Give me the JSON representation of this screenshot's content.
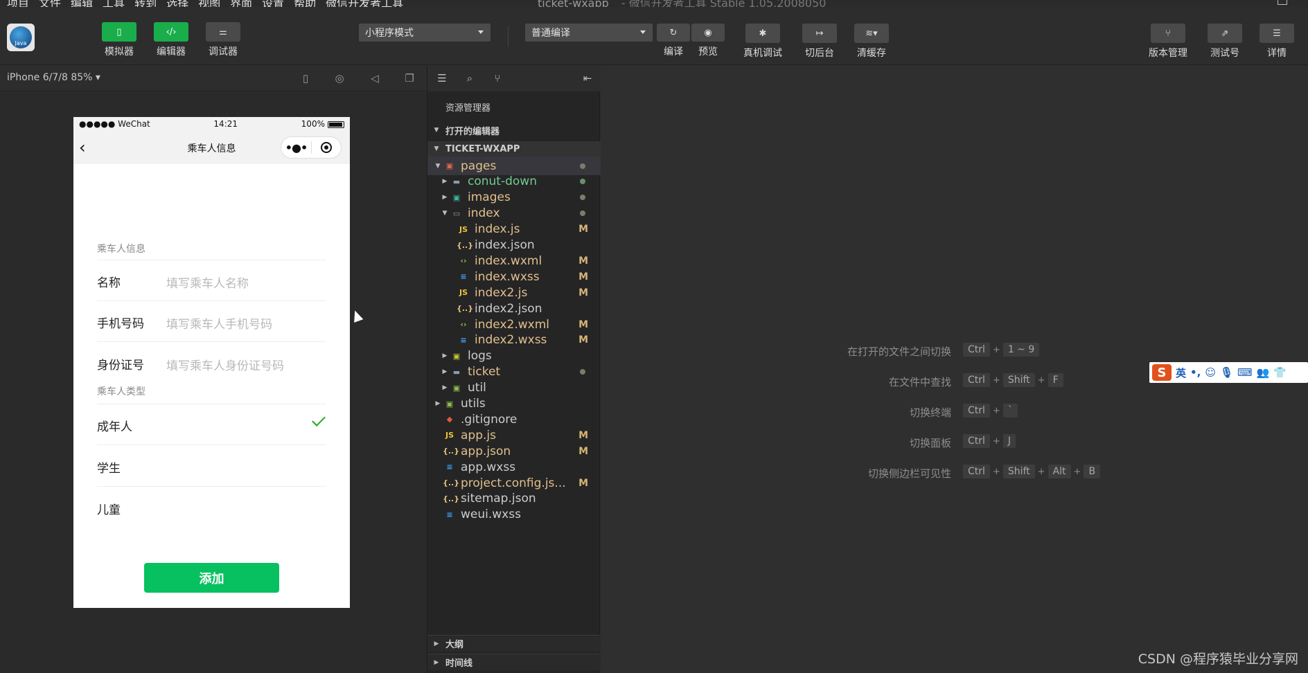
{
  "menu": {
    "items": [
      "项目",
      "文件",
      "编辑",
      "工具",
      "转到",
      "选择",
      "视图",
      "界面",
      "设置",
      "帮助",
      "微信开发者工具"
    ],
    "window_title": "ticket-wxapp",
    "window_subtitle": "- 微信开发者工具 Stable 1.05.2008050"
  },
  "toolbar": {
    "simulator": "模拟器",
    "editor": "编辑器",
    "debugger": "调试器",
    "mode_select": "小程序模式",
    "compile_select": "普通编译",
    "compile": "编译",
    "preview": "预览",
    "real_debug": "真机调试",
    "background": "切后台",
    "clear_cache": "清缓存",
    "version": "版本管理",
    "test_id": "测试号",
    "details": "详情"
  },
  "simulator": {
    "device": "iPhone 6/7/8 85% ▾",
    "status_left": "●●●●● WeChat",
    "status_time": "14:21",
    "status_battery": "100%",
    "nav_title": "乘车人信息",
    "section1": "乘车人信息",
    "field_name_label": "名称",
    "field_name_placeholder": "填写乘车人名称",
    "field_phone_label": "手机号码",
    "field_phone_placeholder": "填写乘车人手机号码",
    "field_id_label": "身份证号",
    "field_id_placeholder": "填写乘车人身份证号码",
    "section2": "乘车人类型",
    "type_adult": "成年人",
    "type_student": "学生",
    "type_child": "儿童",
    "add_button": "添加"
  },
  "explorer": {
    "title": "资源管理器",
    "open_editors": "打开的编辑器",
    "project": "TICKET-WXAPP",
    "outline": "大纲",
    "timeline": "时间线",
    "files": [
      {
        "name": "pages",
        "badge": ""
      },
      {
        "name": "conut-down",
        "badge": ""
      },
      {
        "name": "images",
        "badge": ""
      },
      {
        "name": "index",
        "badge": ""
      },
      {
        "name": "index.js",
        "badge": "M"
      },
      {
        "name": "index.json",
        "badge": ""
      },
      {
        "name": "index.wxml",
        "badge": "M"
      },
      {
        "name": "index.wxss",
        "badge": "M"
      },
      {
        "name": "index2.js",
        "badge": "M"
      },
      {
        "name": "index2.json",
        "badge": ""
      },
      {
        "name": "index2.wxml",
        "badge": "M"
      },
      {
        "name": "index2.wxss",
        "badge": "M"
      },
      {
        "name": "logs",
        "badge": ""
      },
      {
        "name": "ticket",
        "badge": ""
      },
      {
        "name": "util",
        "badge": ""
      },
      {
        "name": "utils",
        "badge": ""
      },
      {
        "name": ".gitignore",
        "badge": ""
      },
      {
        "name": "app.js",
        "badge": "M"
      },
      {
        "name": "app.json",
        "badge": "M"
      },
      {
        "name": "app.wxss",
        "badge": ""
      },
      {
        "name": "project.config.js...",
        "badge": "M"
      },
      {
        "name": "sitemap.json",
        "badge": ""
      },
      {
        "name": "weui.wxss",
        "badge": ""
      }
    ]
  },
  "editor": {
    "hints": [
      {
        "desc": "在打开的文件之间切换",
        "keys": [
          "Ctrl",
          "1 ~ 9"
        ]
      },
      {
        "desc": "在文件中查找",
        "keys": [
          "Ctrl",
          "Shift",
          "F"
        ]
      },
      {
        "desc": "切换终端",
        "keys": [
          "Ctrl",
          "`"
        ]
      },
      {
        "desc": "切换面板",
        "keys": [
          "Ctrl",
          "J"
        ]
      },
      {
        "desc": "切换侧边栏可见性",
        "keys": [
          "Ctrl",
          "Shift",
          "Alt",
          "B"
        ]
      }
    ],
    "ime_label": "英",
    "watermark": "CSDN @程序猿毕业分享网"
  },
  "colors": {
    "accent_green": "#1aad4b",
    "wechat_green": "#07c160",
    "modified": "#e2c08d",
    "untracked": "#73c991"
  }
}
